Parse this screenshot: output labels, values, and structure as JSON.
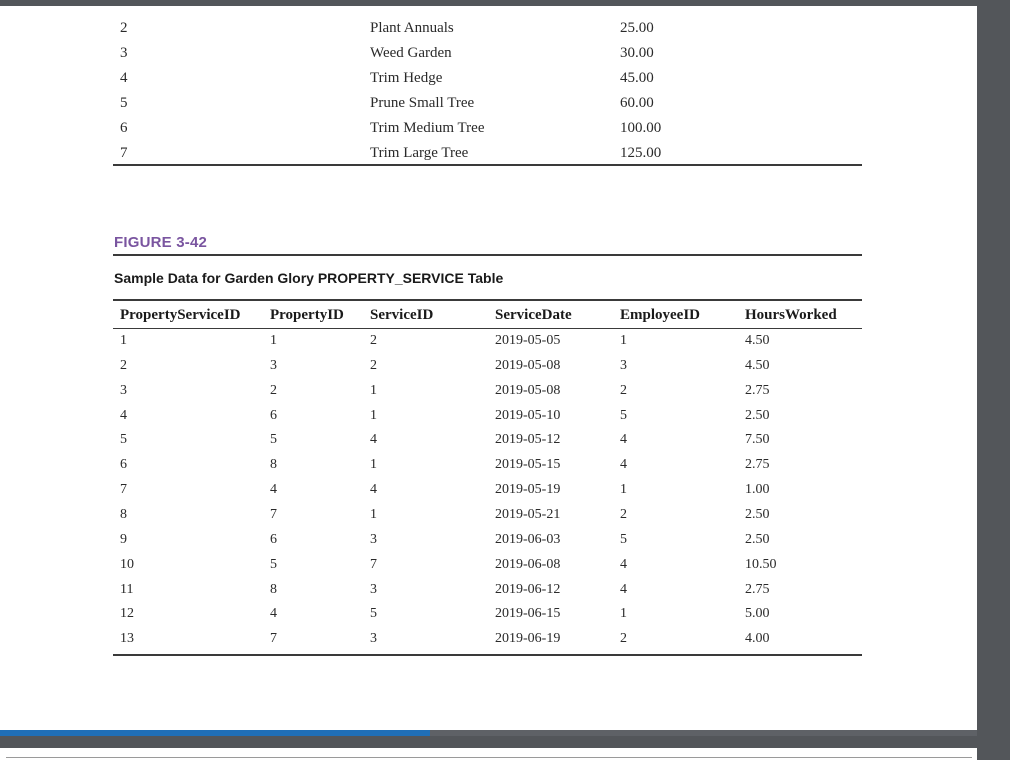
{
  "top_table": {
    "rows": [
      {
        "id": "2",
        "description": "Plant Annuals",
        "cost": "25.00"
      },
      {
        "id": "3",
        "description": "Weed Garden",
        "cost": "30.00"
      },
      {
        "id": "4",
        "description": "Trim Hedge",
        "cost": "45.00"
      },
      {
        "id": "5",
        "description": "Prune Small Tree",
        "cost": "60.00"
      },
      {
        "id": "6",
        "description": "Trim Medium Tree",
        "cost": "100.00"
      },
      {
        "id": "7",
        "description": "Trim Large Tree",
        "cost": "125.00"
      }
    ]
  },
  "figure": {
    "label": "FIGURE 3-42",
    "title": "Sample Data for Garden Glory PROPERTY_SERVICE Table"
  },
  "property_service_table": {
    "columns": [
      "PropertyServiceID",
      "PropertyID",
      "ServiceID",
      "ServiceDate",
      "EmployeeID",
      "HoursWorked"
    ],
    "rows": [
      [
        "1",
        "1",
        "2",
        "2019-05-05",
        "1",
        "4.50"
      ],
      [
        "2",
        "3",
        "2",
        "2019-05-08",
        "3",
        "4.50"
      ],
      [
        "3",
        "2",
        "1",
        "2019-05-08",
        "2",
        "2.75"
      ],
      [
        "4",
        "6",
        "1",
        "2019-05-10",
        "5",
        "2.50"
      ],
      [
        "5",
        "5",
        "4",
        "2019-05-12",
        "4",
        "7.50"
      ],
      [
        "6",
        "8",
        "1",
        "2019-05-15",
        "4",
        "2.75"
      ],
      [
        "7",
        "4",
        "4",
        "2019-05-19",
        "1",
        "1.00"
      ],
      [
        "8",
        "7",
        "1",
        "2019-05-21",
        "2",
        "2.50"
      ],
      [
        "9",
        "6",
        "3",
        "2019-06-03",
        "5",
        "2.50"
      ],
      [
        "10",
        "5",
        "7",
        "2019-06-08",
        "4",
        "10.50"
      ],
      [
        "11",
        "8",
        "3",
        "2019-06-12",
        "4",
        "2.75"
      ],
      [
        "12",
        "4",
        "5",
        "2019-06-15",
        "1",
        "5.00"
      ],
      [
        "13",
        "7",
        "3",
        "2019-06-19",
        "2",
        "4.00"
      ]
    ]
  },
  "viewer": {
    "scroll_progress": 0.44,
    "accent_color": "#1f6fb8",
    "background_color": "#53565a"
  }
}
